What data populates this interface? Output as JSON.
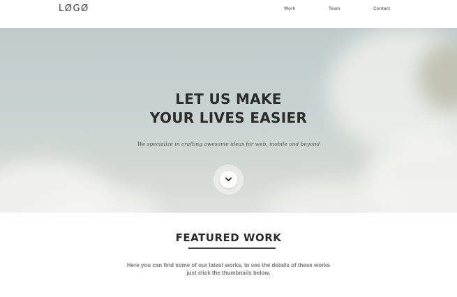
{
  "header": {
    "logo": "LØGØ",
    "nav": [
      "Work",
      "Team",
      "Contact"
    ]
  },
  "hero": {
    "title_line1": "LET US MAKE",
    "title_line2": "YOUR LIVES EASIER",
    "subtitle": "We specialize in crafting awesome ideas for web, mobile and beyond",
    "scroll_icon": "chevron-down-icon"
  },
  "featured": {
    "title": "FEATURED WORK",
    "desc_line1": "Here you can find some of our latest works, to see the details of these works",
    "desc_line2": "just click the thumbnails below."
  }
}
